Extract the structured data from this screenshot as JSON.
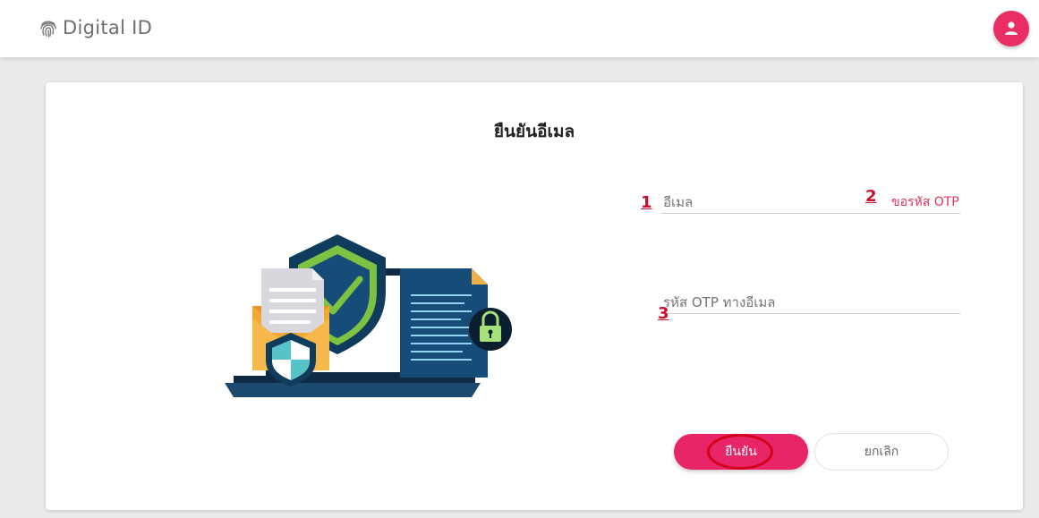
{
  "header": {
    "brand": "Digital ID",
    "logo_icon": "fingerprint-icon",
    "avatar_icon": "user-icon",
    "accent_color": "#ea2d63"
  },
  "card": {
    "title": "ยืนยันอีเมล",
    "illustration": "email-security-illustration",
    "email_field": {
      "placeholder": "อีเมล",
      "value": ""
    },
    "request_otp_link": "ขอรหัส OTP",
    "otp_field": {
      "placeholder": "รหัส OTP ทางอีเมล",
      "value": ""
    },
    "markers": [
      "1",
      "2",
      "3"
    ],
    "confirm_button": "ยืนยัน",
    "cancel_button": "ยกเลิก"
  }
}
